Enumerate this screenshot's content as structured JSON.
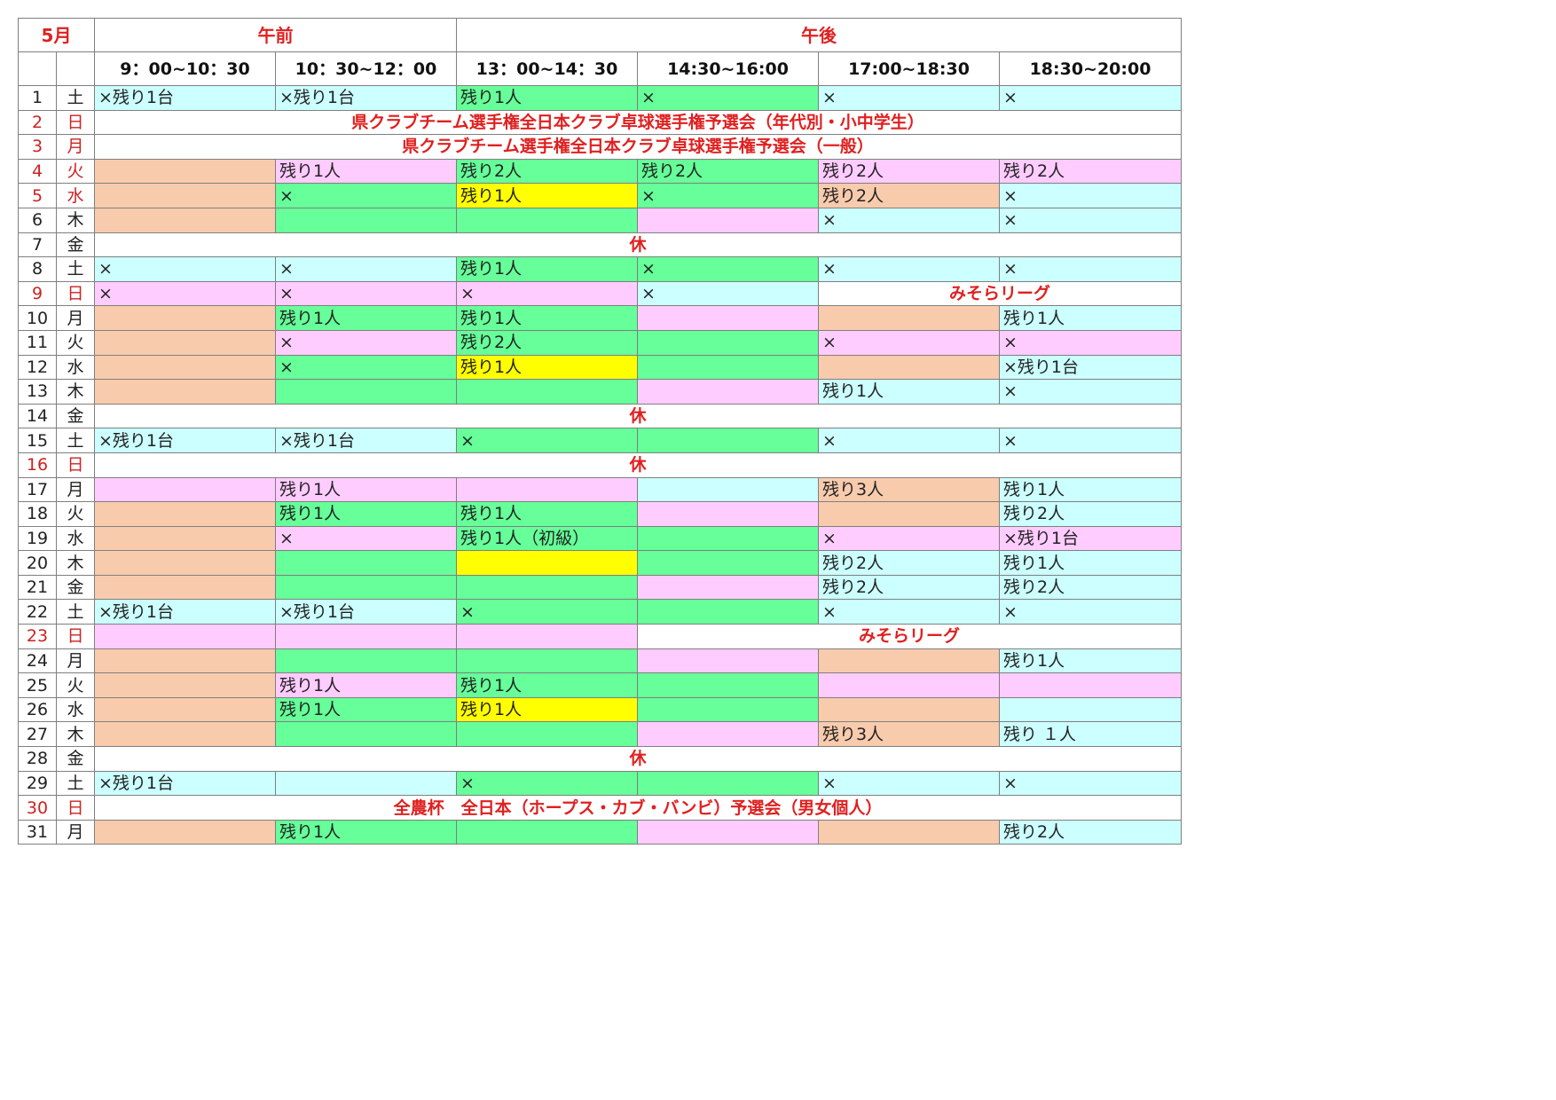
{
  "colors": {
    "blue": "#ccffff",
    "green": "#66ff99",
    "pink": "#ffccff",
    "orange": "#f8cbad",
    "yellow": "#ffff00",
    "white": "#ffffff",
    "red_text": "#e02020"
  },
  "header": {
    "month": "5月",
    "am": "午前",
    "pm": "午後",
    "times": [
      "9：00~10：30",
      "10：30~12：00",
      "13：00~14：30",
      "14:30~16:00",
      "17:00~18:30",
      "18:30~20:00"
    ]
  },
  "rows": [
    {
      "day": "1",
      "dow": "土",
      "red": false,
      "cells": [
        {
          "t": "×残り1台",
          "c": "blue"
        },
        {
          "t": "×残り1台",
          "c": "blue"
        },
        {
          "t": "残り1人",
          "c": "green"
        },
        {
          "t": "×",
          "c": "green"
        },
        {
          "t": "×",
          "c": "blue"
        },
        {
          "t": "×",
          "c": "blue"
        }
      ]
    },
    {
      "day": "2",
      "dow": "日",
      "red": true,
      "cells": [
        {
          "t": "県クラブチーム選手権全日本クラブ卓球選手権予選会（年代別・小中学生）",
          "c": "white",
          "span": 6,
          "event": true
        }
      ]
    },
    {
      "day": "3",
      "dow": "月",
      "red": true,
      "cells": [
        {
          "t": "県クラブチーム選手権全日本クラブ卓球選手権予選会（一般）",
          "c": "white",
          "span": 6,
          "event": true
        }
      ]
    },
    {
      "day": "4",
      "dow": "火",
      "red": true,
      "cells": [
        {
          "t": "",
          "c": "orange"
        },
        {
          "t": "残り1人",
          "c": "pink"
        },
        {
          "t": "残り2人",
          "c": "green"
        },
        {
          "t": "残り2人",
          "c": "green"
        },
        {
          "t": "残り2人",
          "c": "pink"
        },
        {
          "t": "残り2人",
          "c": "pink"
        }
      ]
    },
    {
      "day": "5",
      "dow": "水",
      "red": true,
      "cells": [
        {
          "t": "",
          "c": "orange"
        },
        {
          "t": "×",
          "c": "green"
        },
        {
          "t": "残り1人",
          "c": "yellow"
        },
        {
          "t": "×",
          "c": "green"
        },
        {
          "t": "残り2人",
          "c": "orange"
        },
        {
          "t": "×",
          "c": "blue"
        }
      ]
    },
    {
      "day": "6",
      "dow": "木",
      "red": false,
      "cells": [
        {
          "t": "",
          "c": "orange"
        },
        {
          "t": "",
          "c": "green"
        },
        {
          "t": "",
          "c": "green"
        },
        {
          "t": "",
          "c": "pink"
        },
        {
          "t": "×",
          "c": "blue"
        },
        {
          "t": "×",
          "c": "blue"
        }
      ]
    },
    {
      "day": "7",
      "dow": "金",
      "red": false,
      "cells": [
        {
          "t": "休",
          "c": "white",
          "span": 6,
          "event": true
        }
      ]
    },
    {
      "day": "8",
      "dow": "土",
      "red": false,
      "cells": [
        {
          "t": "×",
          "c": "blue"
        },
        {
          "t": "×",
          "c": "blue"
        },
        {
          "t": "残り1人",
          "c": "green"
        },
        {
          "t": "×",
          "c": "green"
        },
        {
          "t": "×",
          "c": "blue"
        },
        {
          "t": "×",
          "c": "blue"
        }
      ]
    },
    {
      "day": "9",
      "dow": "日",
      "red": true,
      "cells": [
        {
          "t": "×",
          "c": "pink"
        },
        {
          "t": "×",
          "c": "pink"
        },
        {
          "t": "×",
          "c": "pink"
        },
        {
          "t": "×",
          "c": "blue"
        },
        {
          "t": "みそらリーグ",
          "c": "white",
          "span": 2,
          "event": true
        }
      ]
    },
    {
      "day": "10",
      "dow": "月",
      "red": false,
      "cells": [
        {
          "t": "",
          "c": "orange"
        },
        {
          "t": "残り1人",
          "c": "green"
        },
        {
          "t": "残り1人",
          "c": "green"
        },
        {
          "t": "",
          "c": "pink"
        },
        {
          "t": "",
          "c": "orange"
        },
        {
          "t": "残り1人",
          "c": "blue"
        }
      ]
    },
    {
      "day": "11",
      "dow": "火",
      "red": false,
      "cells": [
        {
          "t": "",
          "c": "orange"
        },
        {
          "t": "×",
          "c": "pink"
        },
        {
          "t": "残り2人",
          "c": "green"
        },
        {
          "t": "",
          "c": "green"
        },
        {
          "t": "×",
          "c": "pink"
        },
        {
          "t": "×",
          "c": "pink"
        }
      ]
    },
    {
      "day": "12",
      "dow": "水",
      "red": false,
      "cells": [
        {
          "t": "",
          "c": "orange"
        },
        {
          "t": "×",
          "c": "green"
        },
        {
          "t": "残り1人",
          "c": "yellow"
        },
        {
          "t": "",
          "c": "green"
        },
        {
          "t": "",
          "c": "orange"
        },
        {
          "t": "×残り1台",
          "c": "blue"
        }
      ]
    },
    {
      "day": "13",
      "dow": "木",
      "red": false,
      "cells": [
        {
          "t": "",
          "c": "orange"
        },
        {
          "t": "",
          "c": "green"
        },
        {
          "t": "",
          "c": "green"
        },
        {
          "t": "",
          "c": "pink"
        },
        {
          "t": "残り1人",
          "c": "blue"
        },
        {
          "t": "×",
          "c": "blue"
        }
      ]
    },
    {
      "day": "14",
      "dow": "金",
      "red": false,
      "cells": [
        {
          "t": "休",
          "c": "white",
          "span": 6,
          "event": true
        }
      ]
    },
    {
      "day": "15",
      "dow": "土",
      "red": false,
      "cells": [
        {
          "t": "×残り1台",
          "c": "blue"
        },
        {
          "t": "×残り1台",
          "c": "blue"
        },
        {
          "t": "×",
          "c": "green"
        },
        {
          "t": "",
          "c": "green"
        },
        {
          "t": "×",
          "c": "blue"
        },
        {
          "t": "×",
          "c": "blue"
        }
      ]
    },
    {
      "day": "16",
      "dow": "日",
      "red": true,
      "cells": [
        {
          "t": "休",
          "c": "white",
          "span": 6,
          "event": true
        }
      ]
    },
    {
      "day": "17",
      "dow": "月",
      "red": false,
      "cells": [
        {
          "t": "",
          "c": "pink"
        },
        {
          "t": "残り1人",
          "c": "pink"
        },
        {
          "t": "",
          "c": "pink"
        },
        {
          "t": "",
          "c": "blue"
        },
        {
          "t": "残り3人",
          "c": "orange"
        },
        {
          "t": "残り1人",
          "c": "blue"
        }
      ]
    },
    {
      "day": "18",
      "dow": "火",
      "red": false,
      "cells": [
        {
          "t": "",
          "c": "orange"
        },
        {
          "t": "残り1人",
          "c": "green"
        },
        {
          "t": "残り1人",
          "c": "green"
        },
        {
          "t": "",
          "c": "pink"
        },
        {
          "t": "",
          "c": "orange"
        },
        {
          "t": "残り2人",
          "c": "blue"
        }
      ]
    },
    {
      "day": "19",
      "dow": "水",
      "red": false,
      "cells": [
        {
          "t": "",
          "c": "orange"
        },
        {
          "t": "×",
          "c": "pink"
        },
        {
          "t": "残り1人（初級）",
          "c": "green"
        },
        {
          "t": "",
          "c": "green"
        },
        {
          "t": "×",
          "c": "pink"
        },
        {
          "t": "×残り1台",
          "c": "pink"
        }
      ]
    },
    {
      "day": "20",
      "dow": "木",
      "red": false,
      "cells": [
        {
          "t": "",
          "c": "orange"
        },
        {
          "t": "",
          "c": "green"
        },
        {
          "t": "",
          "c": "yellow"
        },
        {
          "t": "",
          "c": "green"
        },
        {
          "t": "残り2人",
          "c": "blue"
        },
        {
          "t": "残り1人",
          "c": "blue"
        }
      ]
    },
    {
      "day": "21",
      "dow": "金",
      "red": false,
      "cells": [
        {
          "t": "",
          "c": "orange"
        },
        {
          "t": "",
          "c": "green"
        },
        {
          "t": "",
          "c": "green"
        },
        {
          "t": "",
          "c": "pink"
        },
        {
          "t": "残り2人",
          "c": "blue"
        },
        {
          "t": "残り2人",
          "c": "blue"
        }
      ]
    },
    {
      "day": "22",
      "dow": "土",
      "red": false,
      "cells": [
        {
          "t": "×残り1台",
          "c": "blue"
        },
        {
          "t": "×残り1台",
          "c": "blue"
        },
        {
          "t": "×",
          "c": "green"
        },
        {
          "t": "",
          "c": "green"
        },
        {
          "t": "×",
          "c": "blue"
        },
        {
          "t": "×",
          "c": "blue"
        }
      ]
    },
    {
      "day": "23",
      "dow": "日",
      "red": true,
      "cells": [
        {
          "t": "",
          "c": "pink"
        },
        {
          "t": "",
          "c": "pink"
        },
        {
          "t": "",
          "c": "pink"
        },
        {
          "t": "みそらリーグ",
          "c": "white",
          "span": 3,
          "event": true
        }
      ]
    },
    {
      "day": "24",
      "dow": "月",
      "red": false,
      "cells": [
        {
          "t": "",
          "c": "orange"
        },
        {
          "t": "",
          "c": "green"
        },
        {
          "t": "",
          "c": "green"
        },
        {
          "t": "",
          "c": "pink"
        },
        {
          "t": "",
          "c": "orange"
        },
        {
          "t": "残り1人",
          "c": "blue"
        }
      ]
    },
    {
      "day": "25",
      "dow": "火",
      "red": false,
      "cells": [
        {
          "t": "",
          "c": "orange"
        },
        {
          "t": "残り1人",
          "c": "pink"
        },
        {
          "t": "残り1人",
          "c": "green"
        },
        {
          "t": "",
          "c": "green"
        },
        {
          "t": "",
          "c": "pink"
        },
        {
          "t": "",
          "c": "pink"
        }
      ]
    },
    {
      "day": "26",
      "dow": "水",
      "red": false,
      "cells": [
        {
          "t": "",
          "c": "orange"
        },
        {
          "t": "残り1人",
          "c": "green"
        },
        {
          "t": "残り1人",
          "c": "yellow"
        },
        {
          "t": "",
          "c": "green"
        },
        {
          "t": "",
          "c": "orange"
        },
        {
          "t": "",
          "c": "blue"
        }
      ]
    },
    {
      "day": "27",
      "dow": "木",
      "red": false,
      "cells": [
        {
          "t": "",
          "c": "orange"
        },
        {
          "t": "",
          "c": "green"
        },
        {
          "t": "",
          "c": "green"
        },
        {
          "t": "",
          "c": "pink"
        },
        {
          "t": "残り3人",
          "c": "orange"
        },
        {
          "t": "残り １人",
          "c": "blue"
        }
      ]
    },
    {
      "day": "28",
      "dow": "金",
      "red": false,
      "cells": [
        {
          "t": "休",
          "c": "white",
          "span": 6,
          "event": true
        }
      ]
    },
    {
      "day": "29",
      "dow": "土",
      "red": false,
      "cells": [
        {
          "t": "×残り1台",
          "c": "blue"
        },
        {
          "t": "",
          "c": "blue"
        },
        {
          "t": "×",
          "c": "green"
        },
        {
          "t": "",
          "c": "green"
        },
        {
          "t": "×",
          "c": "blue"
        },
        {
          "t": "×",
          "c": "blue"
        }
      ]
    },
    {
      "day": "30",
      "dow": "日",
      "red": true,
      "cells": [
        {
          "t": "全農杯　全日本（ホープス・カブ・バンビ）予選会（男女個人）",
          "c": "white",
          "span": 6,
          "event": true
        }
      ]
    },
    {
      "day": "31",
      "dow": "月",
      "red": false,
      "cells": [
        {
          "t": "",
          "c": "orange"
        },
        {
          "t": "残り1人",
          "c": "green"
        },
        {
          "t": "",
          "c": "green"
        },
        {
          "t": "",
          "c": "pink"
        },
        {
          "t": "",
          "c": "orange"
        },
        {
          "t": "残り2人",
          "c": "blue"
        }
      ]
    }
  ]
}
